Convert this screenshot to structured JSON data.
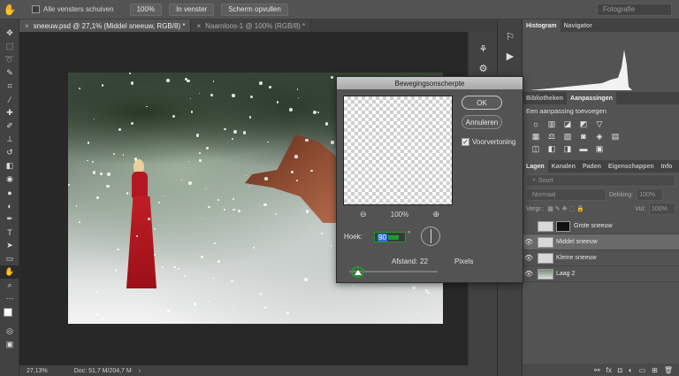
{
  "options_bar": {
    "scroll_all_label": "Alle vensters schuiven",
    "zoom_100": "100%",
    "fit_window": "In venster",
    "fill_screen": "Scherm opvullen",
    "workspace": "Fotografie"
  },
  "tabs": [
    {
      "label": "sneeuw.psd @ 27,1% (Middel sneeuw, RGB/8) *"
    },
    {
      "label": "Naamloos-1 @ 100% (RGB/8) *"
    }
  ],
  "status": {
    "zoom": "27,13%",
    "doc": "Doc: 51,7 M/204,7 M"
  },
  "dialog": {
    "title": "Bewegingsonscherpte",
    "ok": "OK",
    "cancel": "Annuleren",
    "preview_label": "Voorvertoning",
    "preview_checked": true,
    "zoom": "100%",
    "angle_label": "Hoek:",
    "angle_value": "90",
    "angle_unit": "°",
    "distance_label": "Afstand:",
    "distance_value": "22",
    "distance_unit": "Pixels"
  },
  "panels": {
    "top_tabs": [
      "Histogram",
      "Navigator"
    ],
    "adj_tabs": [
      "Bibliotheken",
      "Aanpassingen"
    ],
    "adj_title": "Een aanpassing toevoegen",
    "layer_tabs": [
      "Lagen",
      "Kanalen",
      "Paden",
      "Eigenschappen",
      "Info"
    ],
    "kind_label": "Soort",
    "blend_mode": "Normaal",
    "opacity_label": "Dekking:",
    "opacity_value": "100%",
    "lock_label": "Vergr.:",
    "fill_label": "Vul:",
    "fill_value": "100%",
    "layers": [
      {
        "name": "Grote sneeuw",
        "visible": false,
        "selected": false
      },
      {
        "name": "Middel sneeuw",
        "visible": true,
        "selected": true
      },
      {
        "name": "Kleine sneeuw",
        "visible": true,
        "selected": false
      },
      {
        "name": "Laag 2",
        "visible": true,
        "selected": false
      }
    ]
  },
  "colors": {
    "accent_green": "#1e9a2e",
    "selection_blue": "#2f6dd6"
  }
}
